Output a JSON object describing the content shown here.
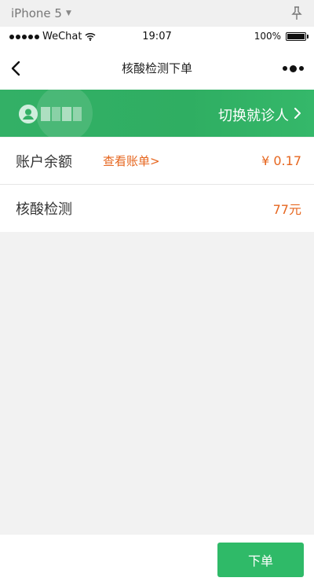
{
  "simulator": {
    "device": "iPhone 5"
  },
  "status": {
    "carrier": "WeChat",
    "time": "19:07",
    "battery": "100%"
  },
  "nav": {
    "title": "核酸检测下单"
  },
  "banner": {
    "switch_label": "切换就诊人"
  },
  "balance": {
    "label": "账户余额",
    "link": "查看账单>",
    "amount": "¥ 0.17"
  },
  "test": {
    "label": "核酸检测",
    "price": "77元"
  },
  "footer": {
    "order_label": "下单"
  },
  "colors": {
    "accent": "#2fba68",
    "banner": "#33b066",
    "orange": "#e6661f"
  }
}
